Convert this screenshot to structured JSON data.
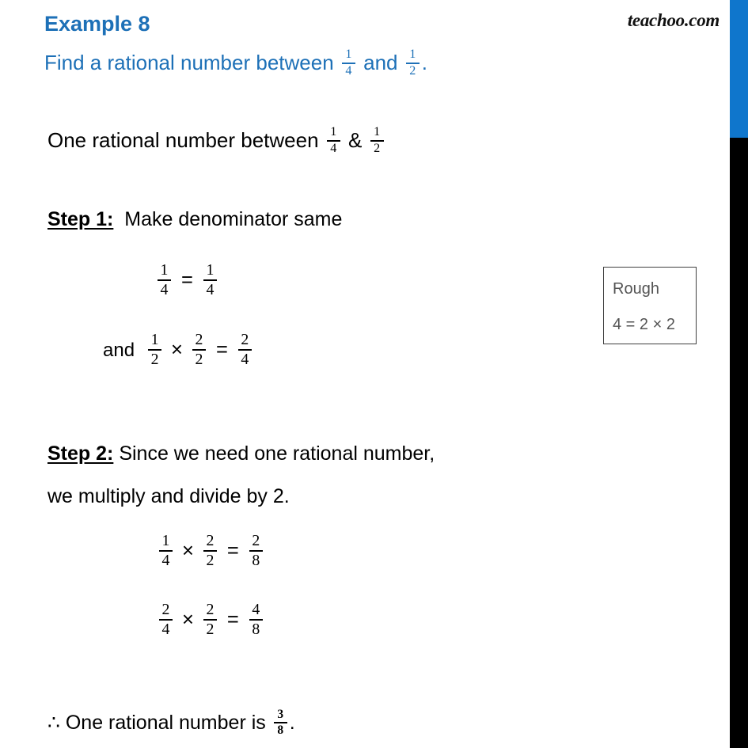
{
  "brand": {
    "logo_text": "teachoo.com"
  },
  "decor": {
    "right_bar_blue_color": "#0f76cc",
    "right_bar_black_color": "#000000",
    "heading_color": "#1d70b7",
    "rough_text_color": "#545454"
  },
  "heading": {
    "example_label": "Example 8"
  },
  "question": {
    "prefix": "Find a rational number between",
    "fraction_1": {
      "num": "1",
      "den": "4"
    },
    "joiner": "and",
    "fraction_2": {
      "num": "1",
      "den": "2"
    },
    "suffix": "."
  },
  "intro": {
    "prefix": "One rational number between",
    "fraction_1": {
      "num": "1",
      "den": "4"
    },
    "joiner": "&",
    "fraction_2": {
      "num": "1",
      "den": "2"
    }
  },
  "step1": {
    "label": "Step 1:",
    "text": "Make denominator same",
    "equations": [
      {
        "lead": "",
        "terms": [
          {
            "type": "frac",
            "num": "1",
            "den": "4"
          },
          {
            "type": "op",
            "value": "="
          },
          {
            "type": "frac",
            "num": "1",
            "den": "4"
          }
        ]
      },
      {
        "lead": "and",
        "terms": [
          {
            "type": "frac",
            "num": "1",
            "den": "2"
          },
          {
            "type": "op",
            "value": "×"
          },
          {
            "type": "frac",
            "num": "2",
            "den": "2"
          },
          {
            "type": "op",
            "value": "="
          },
          {
            "type": "frac",
            "num": "2",
            "den": "4"
          }
        ]
      }
    ]
  },
  "step2": {
    "label": "Step 2:",
    "text_line1": "Since we need one rational number,",
    "text_line2": "we multiply and divide by 2.",
    "equations": [
      {
        "lead": "",
        "terms": [
          {
            "type": "frac",
            "num": "1",
            "den": "4"
          },
          {
            "type": "op",
            "value": "×"
          },
          {
            "type": "frac",
            "num": "2",
            "den": "2"
          },
          {
            "type": "op",
            "value": "="
          },
          {
            "type": "frac",
            "num": "2",
            "den": "8"
          }
        ]
      },
      {
        "lead": "",
        "terms": [
          {
            "type": "frac",
            "num": "2",
            "den": "4"
          },
          {
            "type": "op",
            "value": "×"
          },
          {
            "type": "frac",
            "num": "2",
            "den": "2"
          },
          {
            "type": "op",
            "value": "="
          },
          {
            "type": "frac",
            "num": "4",
            "den": "8"
          }
        ]
      }
    ]
  },
  "rough": {
    "title": "Rough",
    "body": "4 = 2 × 2"
  },
  "conclusion": {
    "symbol": "∴",
    "prefix": "One rational number is",
    "fraction": {
      "num": "3",
      "den": "8"
    },
    "suffix": "."
  }
}
